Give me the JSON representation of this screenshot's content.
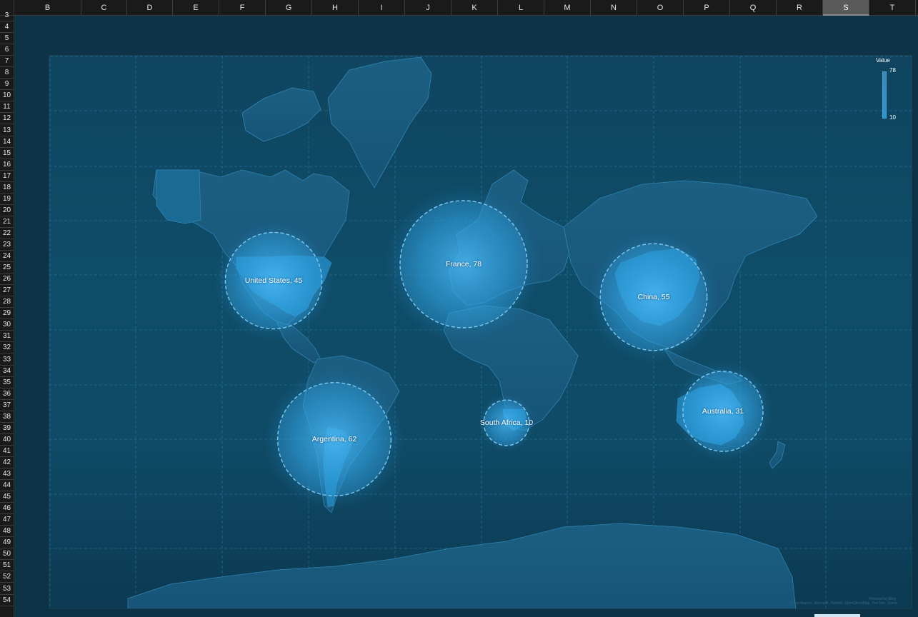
{
  "spreadsheet": {
    "columns": [
      "B",
      "C",
      "D",
      "E",
      "F",
      "G",
      "H",
      "I",
      "J",
      "K",
      "L",
      "M",
      "N",
      "O",
      "P",
      "Q",
      "R",
      "S",
      "T"
    ],
    "selected_column": "S",
    "rows": [
      "3",
      "4",
      "5",
      "6",
      "7",
      "8",
      "9",
      "10",
      "11",
      "12",
      "13",
      "14",
      "15",
      "16",
      "17",
      "18",
      "19",
      "20",
      "21",
      "22",
      "23",
      "24",
      "25",
      "26",
      "27",
      "28",
      "29",
      "30",
      "31",
      "32",
      "33",
      "34",
      "35",
      "36",
      "37",
      "38",
      "39",
      "40",
      "41",
      "42",
      "43",
      "44",
      "45",
      "46",
      "47",
      "48",
      "49",
      "50",
      "51",
      "52",
      "53",
      "54"
    ]
  },
  "map": {
    "legend": {
      "title": "Value",
      "max": "78",
      "min": "10"
    },
    "bubbles": [
      {
        "name": "United States",
        "value": 45,
        "label": "United States, 45"
      },
      {
        "name": "France",
        "value": 78,
        "label": "France, 78"
      },
      {
        "name": "China",
        "value": 55,
        "label": "China, 55"
      },
      {
        "name": "Argentina",
        "value": 62,
        "label": "Argentina, 62"
      },
      {
        "name": "South Africa",
        "value": 10,
        "label": "South Africa, 10"
      },
      {
        "name": "Australia",
        "value": 31,
        "label": "Australia, 31"
      }
    ],
    "powered_by": "Powered by Bing",
    "attribution": "© GeoNames, Microsoft, Navinfo, OpenStreetMap, TomTom, Zenrin",
    "colors": {
      "land": "#1a6a94",
      "ocean": "#0f4a66",
      "bubble": "#3ab0f0",
      "accent": "#4fb4ea"
    }
  }
}
